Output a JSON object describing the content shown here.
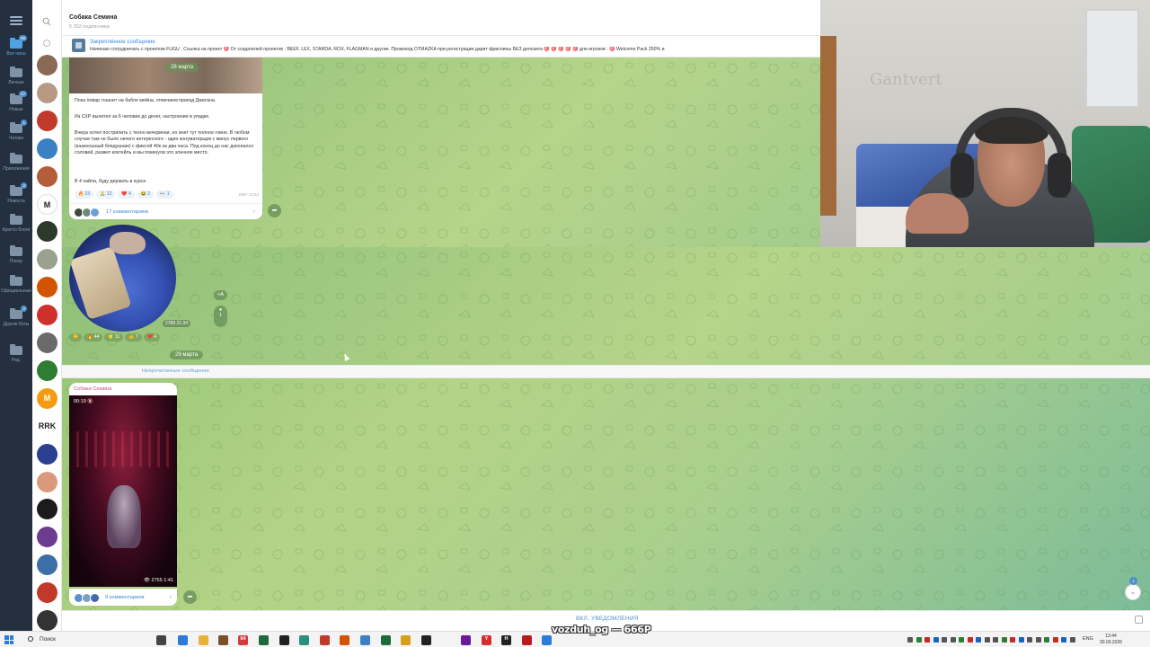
{
  "folders": [
    {
      "label": "Все чаты",
      "badge": "99",
      "active": true
    },
    {
      "label": "Личные",
      "badge": "",
      "active": false
    },
    {
      "label": "Новые",
      "badge": "47",
      "active": false
    },
    {
      "label": "Чатики",
      "badge": "1",
      "active": false
    },
    {
      "label": "Приложения",
      "badge": "",
      "active": false
    },
    {
      "label": "Новости",
      "badge": "2",
      "active": false
    },
    {
      "label": "Крипто блоги",
      "badge": "",
      "active": false
    },
    {
      "label": "Покер",
      "badge": "",
      "active": false
    },
    {
      "label": "Официальные",
      "badge": "",
      "active": false
    },
    {
      "label": "Другие боты",
      "badge": "2",
      "active": false
    },
    {
      "label": "Ред.",
      "badge": "",
      "active": false
    }
  ],
  "header": {
    "title": "Собака Семина",
    "subtitle": "5 352 подписчика"
  },
  "pinned": {
    "title": "Закреплённое сообщение",
    "text": "Начинаю сотрудничать с проектом FUGU . Ссылка на проект 🎯 От создателей проектов : BEEF, LEX, STARDA, ROX, FLAGMAN и другие. Промокод OTMAZKA при регистрации дарит фриспины БЕЗ депозита 🎯 🎯 🎯 🎯 🎯 для игроков : 🎯 Welcome Pack 250% и"
  },
  "post1": {
    "date": "28 марта",
    "paragraphs": [
      "Пока повар тошнит на бабле мейна, отмечаем приезд Джатана.",
      "Из СХР вылетел за 6 человек до денег, настроение в упадке.",
      "Вчера хотел пострипить с техно вечеринки, но инет тут полное говно. В любом случае там не было ничего интересного - один конуматорщик с минус первого (казиношный блядушник) с фиксой 40к за два часа. Под конец до нас докопался соловей, развел коктейль и мы покинули это злачное место.",
      "В 4 хайла, буду держать в курсе."
    ],
    "reactions": [
      "🔥 23",
      "🙏 12",
      "❤️ 4",
      "😂 2",
      "👀 1"
    ],
    "views": "2697 13:54",
    "comments": "17 комментариев"
  },
  "round_video": {
    "duration": "00:13",
    "views": "2789 21:34",
    "reactions": [
      "😊",
      "🔥 44",
      "⭐ 11",
      "👍 7",
      "❤️ 4"
    ],
    "side_count": "+A",
    "side_comments": "1"
  },
  "date2": "29 марта",
  "unread_label": "Непрочитанные сообщения",
  "video_post": {
    "sender": "Собака Семина",
    "time": "00:19 🔇",
    "stats": "👁 2755 1:41",
    "comments": "9 комментариев"
  },
  "scroll_badge": "1",
  "bottom": {
    "notif": "ВКЛ. УВЕДОМЛЕНИЯ"
  },
  "webcam": {
    "wall_text": "Gantvert"
  },
  "taskbar": {
    "search": "Поиск",
    "lang": "ENG",
    "time": "13:44",
    "date": "30.03.2026",
    "apps": [
      "64",
      "Y",
      "H"
    ]
  },
  "overlay": "vozduh_og — 666P",
  "colors": {
    "folder_rail": "#24303f",
    "accent": "#4f8ec9",
    "chat_bg": "#a6cc82",
    "sender": "#d04a6e"
  }
}
